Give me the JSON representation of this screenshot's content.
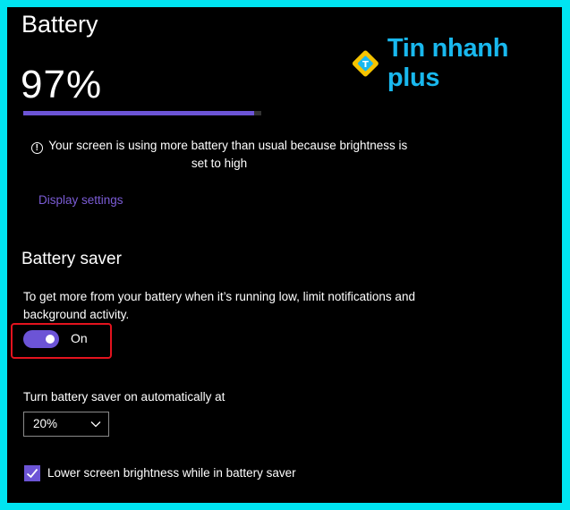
{
  "header": {
    "title": "Battery"
  },
  "logo": {
    "text": "Tin nhanh plus",
    "mark_letter": "T",
    "brand_color": "#19b8ee",
    "mark_color": "#f5c400"
  },
  "battery": {
    "percent_label": "97%",
    "level": 0.97
  },
  "warning": {
    "icon": "info-icon",
    "text": "Your screen is using more battery than usual because brightness is set to high"
  },
  "links": {
    "display_settings": "Display settings"
  },
  "battery_saver": {
    "title": "Battery saver",
    "description": "To get more from your battery when it’s running low, limit notifications and background activity.",
    "toggle": {
      "state": "on",
      "label": "On"
    },
    "auto_label": "Turn battery saver on automatically at",
    "threshold": {
      "selected": "20%"
    },
    "lower_brightness": {
      "checked": true,
      "label": "Lower screen brightness while in battery saver"
    }
  },
  "colors": {
    "accent": "#6c54d6",
    "link": "#7b5cd6",
    "highlight": "#e3131e",
    "frame": "#00e5f2"
  }
}
